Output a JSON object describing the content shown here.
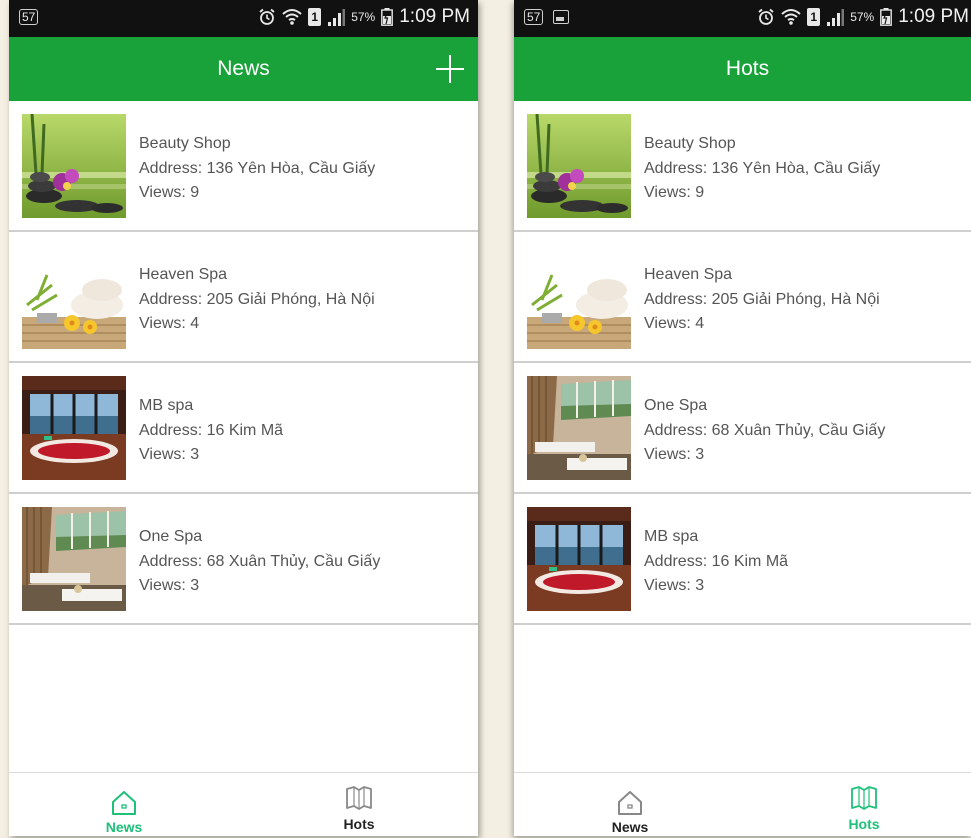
{
  "colors": {
    "app_bar": "#1aa23a",
    "active_tab": "#1ec07a",
    "inactive_tab": "#222222",
    "status_bar": "#111111",
    "divider": "#cfcfcf",
    "item_text": "#555555"
  },
  "status_bar": {
    "notification_badge": "57",
    "battery_percent": "57%",
    "time": "1:09 PM",
    "sim_slot": "1",
    "icons": [
      "alarm-icon",
      "wifi-icon",
      "sim-icon",
      "signal-icon",
      "battery-icon"
    ]
  },
  "screens": [
    {
      "title": "News",
      "has_add_button": true,
      "active_tab": "news",
      "items": [
        {
          "name": "Beauty Shop",
          "address": "Address: 136 Yên Hòa, Cầu Giấy",
          "views": "Views: 9",
          "image": "orchid-stones"
        },
        {
          "name": "Heaven Spa",
          "address": "Address: 205 Giải Phóng, Hà Nội",
          "views": "Views: 4",
          "image": "towels-flowers"
        },
        {
          "name": "MB spa",
          "address": "Address: 16 Kim Mã",
          "views": "Views: 3",
          "image": "rose-bath"
        },
        {
          "name": "One Spa",
          "address": "Address: 68 Xuân Thủy, Cầu Giấy",
          "views": "Views: 3",
          "image": "massage-room"
        }
      ]
    },
    {
      "title": "Hots",
      "has_add_button": false,
      "active_tab": "hots",
      "items": [
        {
          "name": "Beauty Shop",
          "address": "Address: 136 Yên Hòa, Cầu Giấy",
          "views": "Views: 9",
          "image": "orchid-stones"
        },
        {
          "name": "Heaven Spa",
          "address": "Address: 205 Giải Phóng, Hà Nội",
          "views": "Views: 4",
          "image": "towels-flowers"
        },
        {
          "name": "One Spa",
          "address": "Address: 68 Xuân Thủy, Cầu Giấy",
          "views": "Views: 3",
          "image": "massage-room"
        },
        {
          "name": "MB spa",
          "address": "Address: 16 Kim Mã",
          "views": "Views: 3",
          "image": "rose-bath"
        }
      ]
    }
  ],
  "tabs": [
    {
      "id": "news",
      "label": "News",
      "icon": "home-icon"
    },
    {
      "id": "hots",
      "label": "Hots",
      "icon": "book-icon"
    }
  ]
}
